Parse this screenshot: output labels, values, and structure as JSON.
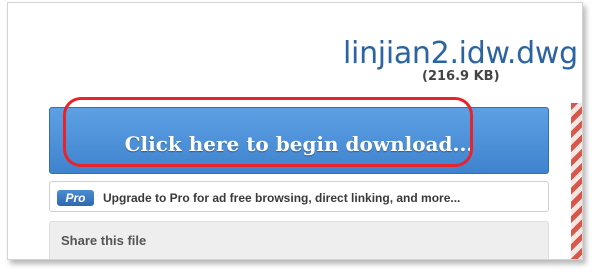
{
  "file": {
    "name": "linjian2.idw.dwg",
    "size": "(216.9 KB)"
  },
  "download": {
    "label": "Click here to begin download..."
  },
  "pro": {
    "badge": "Pro",
    "text": "Upgrade to Pro for ad free browsing, direct linking, and more..."
  },
  "share": {
    "title": "Share this file"
  },
  "colors": {
    "title_blue": "#2b64a0",
    "button_blue": "#4a8fd9",
    "highlight_red": "#e8232a"
  }
}
